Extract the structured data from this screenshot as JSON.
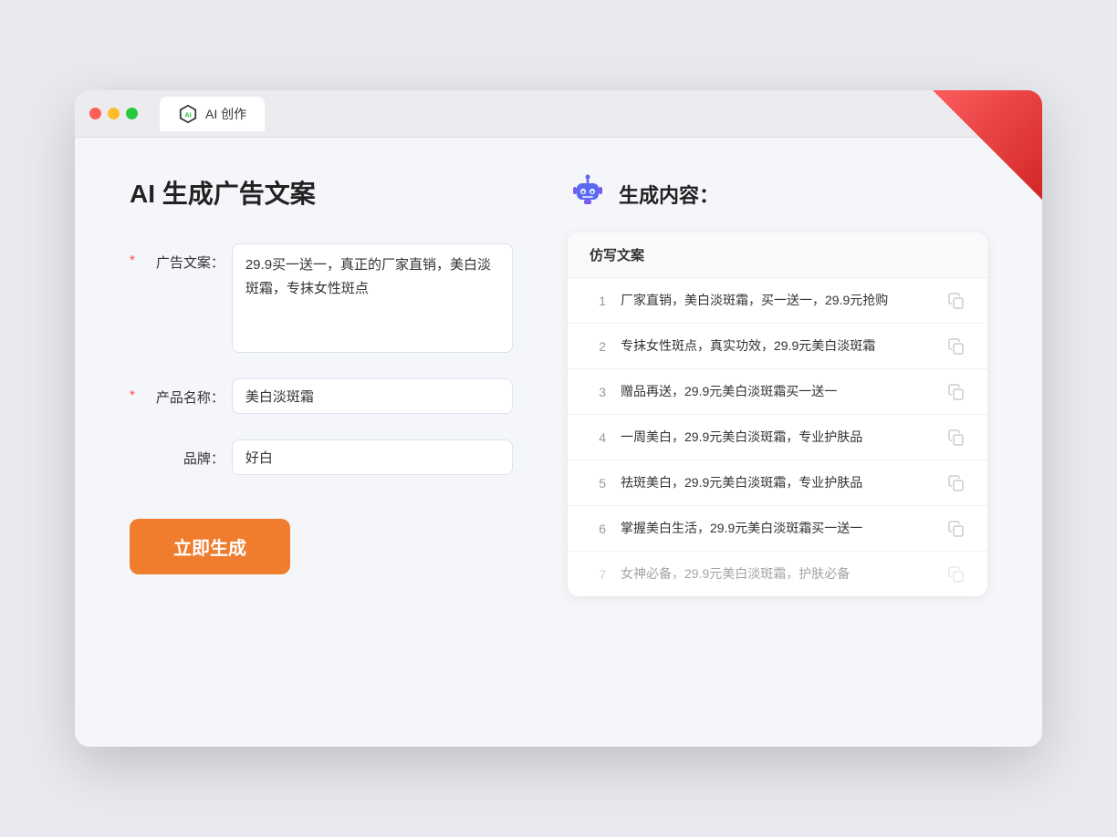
{
  "tab": {
    "label": "AI 创作"
  },
  "left": {
    "title": "AI 生成广告文案",
    "fields": {
      "ad_copy": {
        "label": "广告文案：",
        "required": true,
        "value": "29.9买一送一，真正的厂家直销，美白淡斑霜，专抹女性斑点",
        "placeholder": ""
      },
      "product_name": {
        "label": "产品名称：",
        "required": true,
        "value": "美白淡斑霜",
        "placeholder": ""
      },
      "brand": {
        "label": "品牌：",
        "required": false,
        "value": "好白",
        "placeholder": ""
      }
    },
    "generate_button": "立即生成"
  },
  "right": {
    "title": "生成内容：",
    "table_header": "仿写文案",
    "items": [
      {
        "num": "1",
        "text": "厂家直销，美白淡斑霜，买一送一，29.9元抢购",
        "dimmed": false
      },
      {
        "num": "2",
        "text": "专抹女性斑点，真实功效，29.9元美白淡斑霜",
        "dimmed": false
      },
      {
        "num": "3",
        "text": "赠品再送，29.9元美白淡斑霜买一送一",
        "dimmed": false
      },
      {
        "num": "4",
        "text": "一周美白，29.9元美白淡斑霜，专业护肤品",
        "dimmed": false
      },
      {
        "num": "5",
        "text": "祛斑美白，29.9元美白淡斑霜，专业护肤品",
        "dimmed": false
      },
      {
        "num": "6",
        "text": "掌握美白生活，29.9元美白淡斑霜买一送一",
        "dimmed": false
      },
      {
        "num": "7",
        "text": "女神必备，29.9元美白淡斑霜，护肤必备",
        "dimmed": true
      }
    ]
  },
  "colors": {
    "accent_orange": "#f07c2e",
    "required_star": "#ff4d4f",
    "robot_blue": "#5b6af0",
    "robot_purple": "#7c5af0"
  }
}
